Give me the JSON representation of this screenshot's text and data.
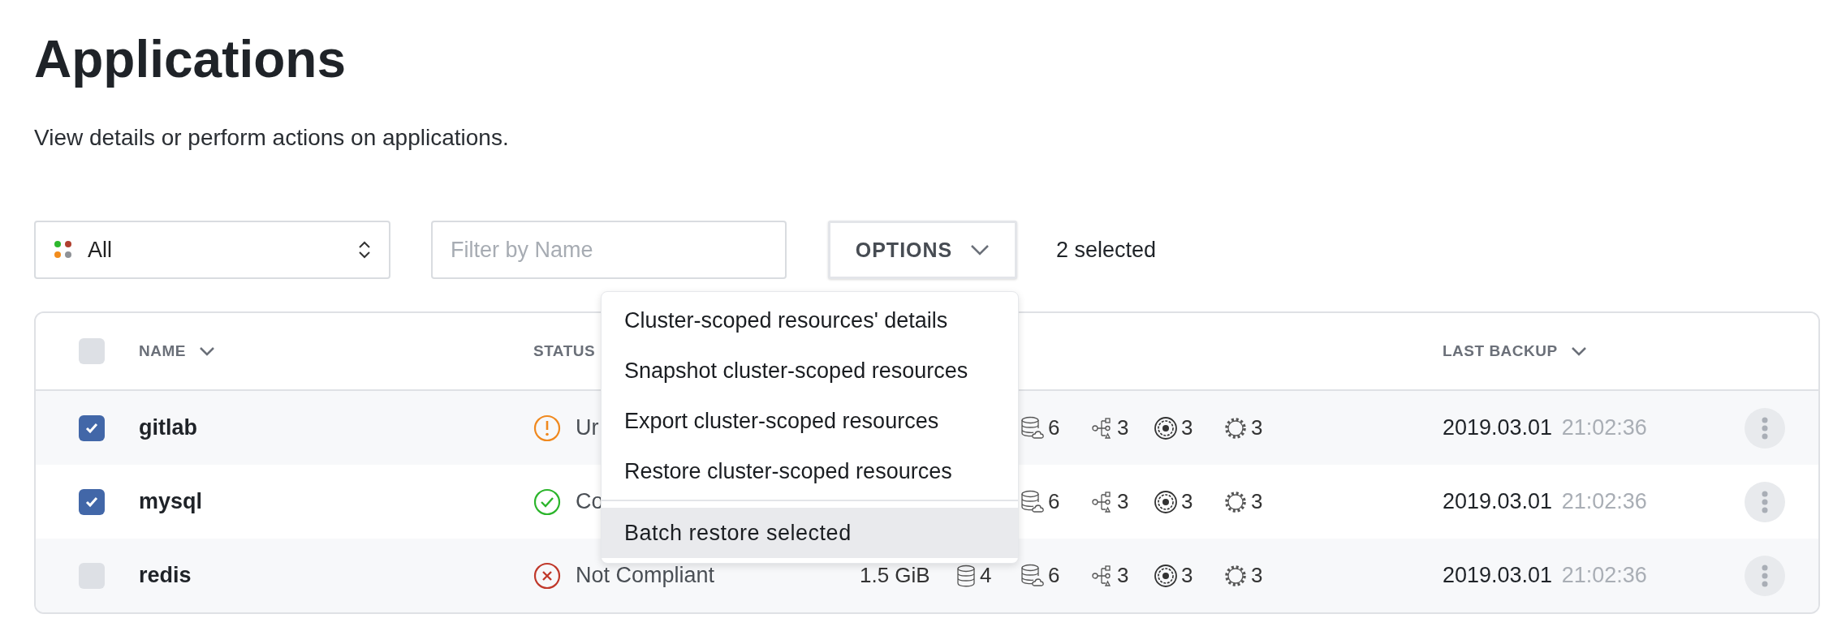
{
  "page": {
    "title": "Applications",
    "subtitle": "View details or perform actions on applications."
  },
  "toolbar": {
    "status_filter": {
      "value": "All"
    },
    "name_filter": {
      "placeholder": "Filter by Name"
    },
    "options_button": {
      "label": "OPTIONS",
      "expanded": true
    },
    "selection_count": "2 selected"
  },
  "options_menu": {
    "items": [
      {
        "kind": "item",
        "label": "Cluster-scoped resources' details",
        "highlighted": false
      },
      {
        "kind": "item",
        "label": "Snapshot cluster-scoped resources",
        "highlighted": false
      },
      {
        "kind": "item",
        "label": "Export cluster-scoped resources",
        "highlighted": false
      },
      {
        "kind": "item",
        "label": "Restore cluster-scoped resources",
        "highlighted": false
      },
      {
        "kind": "separator"
      },
      {
        "kind": "item",
        "label": "Batch restore selected",
        "highlighted": true
      }
    ]
  },
  "table": {
    "select_all": {
      "checked": false
    },
    "columns": [
      {
        "label": "NAME",
        "sortable": true
      },
      {
        "label": "STATUS",
        "sortable": false
      },
      {
        "label": "LAST BACKUP",
        "sortable": true
      }
    ],
    "rows": [
      {
        "name": "gitlab",
        "checked": true,
        "status": {
          "kind": "warning",
          "text": "Ur"
        },
        "metrics": [
          {
            "kind": "cloud-database",
            "value": "6"
          },
          {
            "kind": "tree",
            "value": "3"
          },
          {
            "kind": "ring-gear",
            "value": "3"
          },
          {
            "kind": "gear",
            "value": "3"
          }
        ],
        "last_backup": {
          "date": "2019.03.01",
          "time": "21:02:36"
        }
      },
      {
        "name": "mysql",
        "checked": true,
        "status": {
          "kind": "ok",
          "text": "Co"
        },
        "metrics": [
          {
            "kind": "cloud-database",
            "value": "6"
          },
          {
            "kind": "tree",
            "value": "3"
          },
          {
            "kind": "ring-gear",
            "value": "3"
          },
          {
            "kind": "gear",
            "value": "3"
          }
        ],
        "last_backup": {
          "date": "2019.03.01",
          "time": "21:02:36"
        }
      },
      {
        "name": "redis",
        "checked": false,
        "status": {
          "kind": "error",
          "text": "Not Compliant"
        },
        "size": "1.5 GiB",
        "metrics": [
          {
            "kind": "database",
            "value": "4"
          },
          {
            "kind": "cloud-database",
            "value": "6"
          },
          {
            "kind": "tree",
            "value": "3"
          },
          {
            "kind": "ring-gear",
            "value": "3"
          },
          {
            "kind": "gear",
            "value": "3"
          }
        ],
        "last_backup": {
          "date": "2019.03.01",
          "time": "21:02:36"
        }
      }
    ]
  }
}
